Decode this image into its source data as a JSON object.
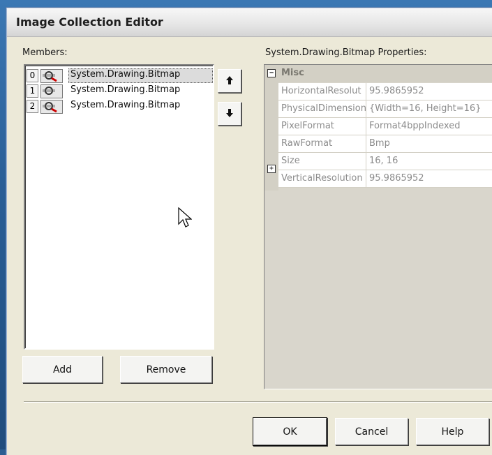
{
  "window": {
    "title": "Image Collection Editor"
  },
  "members": {
    "label": "Members:",
    "items": [
      {
        "index": "0",
        "name": "System.Drawing.Bitmap",
        "selected": true
      },
      {
        "index": "1",
        "name": "System.Drawing.Bitmap",
        "selected": false
      },
      {
        "index": "2",
        "name": "System.Drawing.Bitmap",
        "selected": false
      }
    ],
    "add_label": "Add",
    "remove_label": "Remove",
    "move_up_icon": "arrow-up-icon",
    "move_down_icon": "arrow-down-icon"
  },
  "properties": {
    "label": "System.Drawing.Bitmap Properties:",
    "category": "Misc",
    "rows": [
      {
        "name": "HorizontalResolut",
        "value": "95.9865952"
      },
      {
        "name": "PhysicalDimension",
        "value": "{Width=16, Height=16}"
      },
      {
        "name": "PixelFormat",
        "value": "Format4bppIndexed"
      },
      {
        "name": "RawFormat",
        "value": "Bmp"
      },
      {
        "name": "Size",
        "value": "16, 16"
      },
      {
        "name": "VerticalResolution",
        "value": "95.9865952"
      }
    ]
  },
  "footer": {
    "ok_label": "OK",
    "cancel_label": "Cancel",
    "help_label": "Help"
  },
  "colors": {
    "dialog_bg": "#ece9d8",
    "selection_bg": "#dcdcdc",
    "grid_gutter": "#d3d0c5",
    "disabled_text": "#8c8c8c"
  }
}
